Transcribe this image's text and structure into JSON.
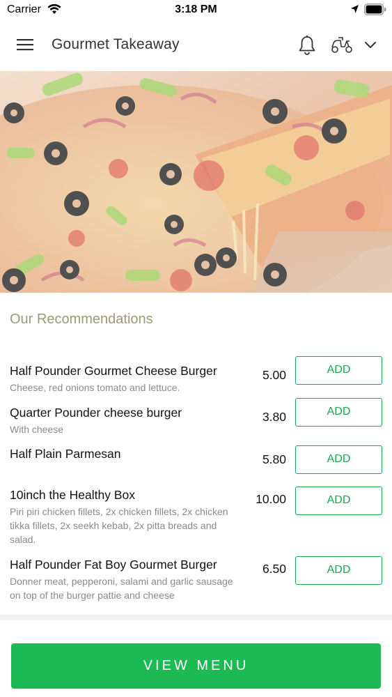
{
  "status_bar": {
    "carrier": "Carrier",
    "time": "3:18 PM",
    "icons": [
      "wifi-icon",
      "location-icon",
      "battery-icon"
    ]
  },
  "header": {
    "title": "Gourmet Takeaway",
    "icons": [
      "menu-icon",
      "bell-icon",
      "scooter-icon",
      "chevron-down-icon"
    ]
  },
  "hero": {
    "image": "pizza-hero-image"
  },
  "recommendations": {
    "title": "Our Recommendations",
    "items": [
      {
        "name": "Half Pounder Gourmet Cheese Burger",
        "description": "Cheese, red onions tomato and lettuce.",
        "price": "5.00",
        "button": "ADD"
      },
      {
        "name": "Quarter Pounder cheese burger",
        "description": "With cheese",
        "price": "3.80",
        "button": "ADD"
      },
      {
        "name": "Half Plain Parmesan",
        "description": "",
        "price": "5.80",
        "button": "ADD"
      },
      {
        "name": "10inch the Healthy Box",
        "description": "Piri piri chicken fillets, 2x chicken fillets, 2x chicken tikka fillets, 2x seekh kebab, 2x pitta breads and salad.",
        "price": "10.00",
        "button": "ADD"
      },
      {
        "name": "Half Pounder Fat Boy Gourmet Burger",
        "description": "Donner meat, pepperoni, salami and garlic sausage on top of the burger pattie and cheese",
        "price": "6.50",
        "button": "ADD"
      }
    ]
  },
  "footer": {
    "view_menu": "VIEW MENU"
  },
  "colors": {
    "accent_green": "#1db954",
    "outline_green": "#1aa84f",
    "section_title": "#9a9a74"
  }
}
